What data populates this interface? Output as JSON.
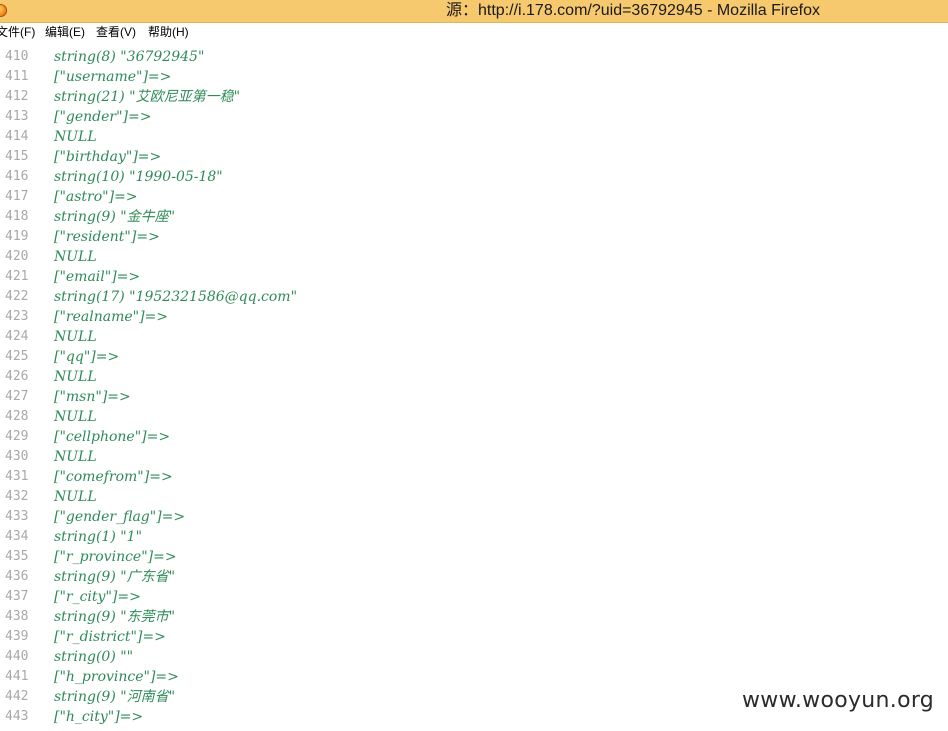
{
  "window": {
    "title": "源：http://i.178.com/?uid=36792945 - Mozilla Firefox"
  },
  "menu": [
    {
      "label": "文件(F)"
    },
    {
      "label": "编辑(E)"
    },
    {
      "label": "查看(V)"
    },
    {
      "label": "帮助(H)"
    }
  ],
  "source": {
    "lines": [
      {
        "n": "410",
        "text": "string(8) \"36792945\""
      },
      {
        "n": "411",
        "text": "[\"username\"]=>"
      },
      {
        "n": "412",
        "text": "string(21) \"艾欧尼亚第一稳\""
      },
      {
        "n": "413",
        "text": "[\"gender\"]=>"
      },
      {
        "n": "414",
        "text": "NULL"
      },
      {
        "n": "415",
        "text": "[\"birthday\"]=>"
      },
      {
        "n": "416",
        "text": "string(10) \"1990-05-18\""
      },
      {
        "n": "417",
        "text": "[\"astro\"]=>"
      },
      {
        "n": "418",
        "text": "string(9) \"金牛座\""
      },
      {
        "n": "419",
        "text": "[\"resident\"]=>"
      },
      {
        "n": "420",
        "text": "NULL"
      },
      {
        "n": "421",
        "text": "[\"email\"]=>"
      },
      {
        "n": "422",
        "text": "string(17) \"1952321586@qq.com\""
      },
      {
        "n": "423",
        "text": "[\"realname\"]=>"
      },
      {
        "n": "424",
        "text": "NULL"
      },
      {
        "n": "425",
        "text": "[\"qq\"]=>"
      },
      {
        "n": "426",
        "text": "NULL"
      },
      {
        "n": "427",
        "text": "[\"msn\"]=>"
      },
      {
        "n": "428",
        "text": "NULL"
      },
      {
        "n": "429",
        "text": "[\"cellphone\"]=>"
      },
      {
        "n": "430",
        "text": "NULL"
      },
      {
        "n": "431",
        "text": "[\"comefrom\"]=>"
      },
      {
        "n": "432",
        "text": "NULL"
      },
      {
        "n": "433",
        "text": "[\"gender_flag\"]=>"
      },
      {
        "n": "434",
        "text": "string(1) \"1\""
      },
      {
        "n": "435",
        "text": "[\"r_province\"]=>"
      },
      {
        "n": "436",
        "text": "string(9) \"广东省\""
      },
      {
        "n": "437",
        "text": "[\"r_city\"]=>"
      },
      {
        "n": "438",
        "text": "string(9) \"东莞市\""
      },
      {
        "n": "439",
        "text": "[\"r_district\"]=>"
      },
      {
        "n": "440",
        "text": "string(0) \"\""
      },
      {
        "n": "441",
        "text": "[\"h_province\"]=>"
      },
      {
        "n": "442",
        "text": "string(9) \"河南省\""
      },
      {
        "n": "443",
        "text": "[\"h_city\"]=>"
      }
    ]
  },
  "watermark": "www.wooyun.org",
  "colors": {
    "titlebar": "#f6c96e",
    "code_text": "#2e8b57",
    "line_number": "#a8a8a8"
  }
}
